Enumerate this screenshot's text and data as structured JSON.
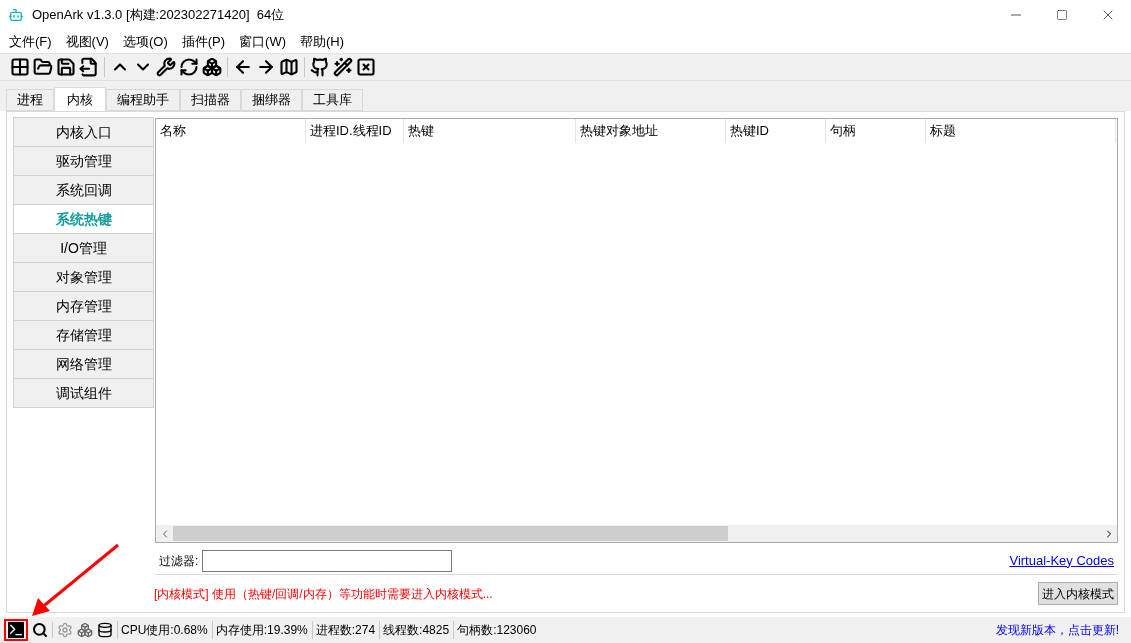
{
  "window": {
    "title": "OpenArk v1.3.0 [构建:202302271420]  64位"
  },
  "menu": [
    "文件(F)",
    "视图(V)",
    "选项(O)",
    "插件(P)",
    "窗口(W)",
    "帮助(H)"
  ],
  "tabs": [
    {
      "label": "进程",
      "selected": false
    },
    {
      "label": "内核",
      "selected": true
    },
    {
      "label": "编程助手",
      "selected": false
    },
    {
      "label": "扫描器",
      "selected": false
    },
    {
      "label": "捆绑器",
      "selected": false
    },
    {
      "label": "工具库",
      "selected": false
    }
  ],
  "sidebar": {
    "items": [
      {
        "label": "内核入口",
        "selected": false
      },
      {
        "label": "驱动管理",
        "selected": false
      },
      {
        "label": "系统回调",
        "selected": false
      },
      {
        "label": "系统热键",
        "selected": true
      },
      {
        "label": "I/O管理",
        "selected": false
      },
      {
        "label": "对象管理",
        "selected": false
      },
      {
        "label": "内存管理",
        "selected": false
      },
      {
        "label": "存储管理",
        "selected": false
      },
      {
        "label": "网络管理",
        "selected": false
      },
      {
        "label": "调试组件",
        "selected": false
      }
    ]
  },
  "table": {
    "columns": [
      "名称",
      "进程ID.线程ID",
      "热键",
      "热键对象地址",
      "热键ID",
      "句柄",
      "标题"
    ]
  },
  "filter": {
    "label": "过滤器:",
    "link": "Virtual-Key Codes"
  },
  "notice": "[内核模式] 使用（热键/回调/内存）等功能时需要进入内核模式...",
  "enter_button": "进入内核模式",
  "status_bar": {
    "stats": [
      "CPU使用:0.68%",
      "内存使用:19.39%",
      "进程数:274",
      "线程数:4825",
      "句柄数:123060"
    ],
    "update_link": "发现新版本，点击更新!"
  }
}
